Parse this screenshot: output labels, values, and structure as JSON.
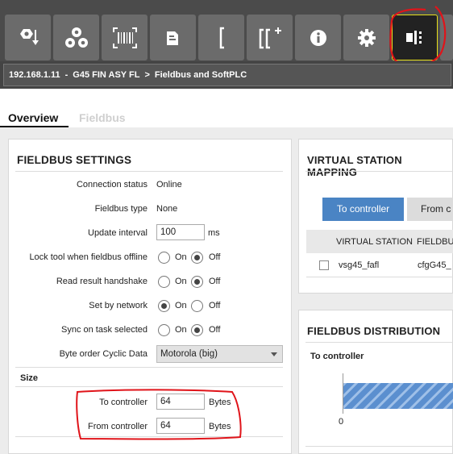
{
  "toolbar": {
    "buttons": [
      {
        "name": "tightening-icon"
      },
      {
        "name": "gears-icon"
      },
      {
        "name": "barcode-icon"
      },
      {
        "name": "controller-config-icon"
      },
      {
        "name": "bracket-icon"
      },
      {
        "name": "bracket-add-icon"
      },
      {
        "name": "info-icon"
      },
      {
        "name": "settings-gear-icon"
      },
      {
        "name": "fieldbus-icon"
      }
    ],
    "active_button": "fieldbus-icon",
    "accent": "#e6e01a",
    "annotation_color": "#e0141a"
  },
  "breadcrumb": {
    "ip": "192.168.1.11",
    "controller": "G45 FIN ASY FL",
    "separator": ">",
    "page": "Fieldbus and SoftPLC"
  },
  "tabs": {
    "overview": "Overview",
    "fieldbus": "Fieldbus"
  },
  "fieldbus_settings": {
    "title": "FIELDBUS SETTINGS",
    "connection_status_label": "Connection status",
    "connection_status_value": "Online",
    "fieldbus_type_label": "Fieldbus type",
    "fieldbus_type_value": "None",
    "update_interval_label": "Update interval",
    "update_interval_value": "100",
    "update_interval_unit": "ms",
    "on_label": "On",
    "off_label": "Off",
    "lock_tool_label": "Lock tool when fieldbus offline",
    "lock_tool_selected": "Off",
    "read_result_label": "Read result handshake",
    "read_result_selected": "Off",
    "set_by_network_label": "Set by network",
    "set_by_network_selected": "On",
    "sync_task_label": "Sync on task selected",
    "sync_task_selected": "Off",
    "byte_order_label": "Byte order Cyclic Data",
    "byte_order_value": "Motorola (big)",
    "size_label": "Size",
    "to_controller_label": "To controller",
    "to_controller_value": "64",
    "from_controller_label": "From controller",
    "from_controller_value": "64",
    "bytes_unit": "Bytes"
  },
  "virtual_station_mapping": {
    "title": "VIRTUAL STATION MAPPING",
    "to_controller_button": "To controller",
    "from_controller_button": "From c",
    "column_virtual_station": "VIRTUAL STATION",
    "column_fieldbus": "FIELDBUS",
    "row_station": "vsg45_fafl",
    "row_fieldbus": "cfgG45_"
  },
  "fieldbus_distribution": {
    "title": "FIELDBUS DISTRIBUTION",
    "to_controller_label": "To controller",
    "axis_start": "0"
  }
}
